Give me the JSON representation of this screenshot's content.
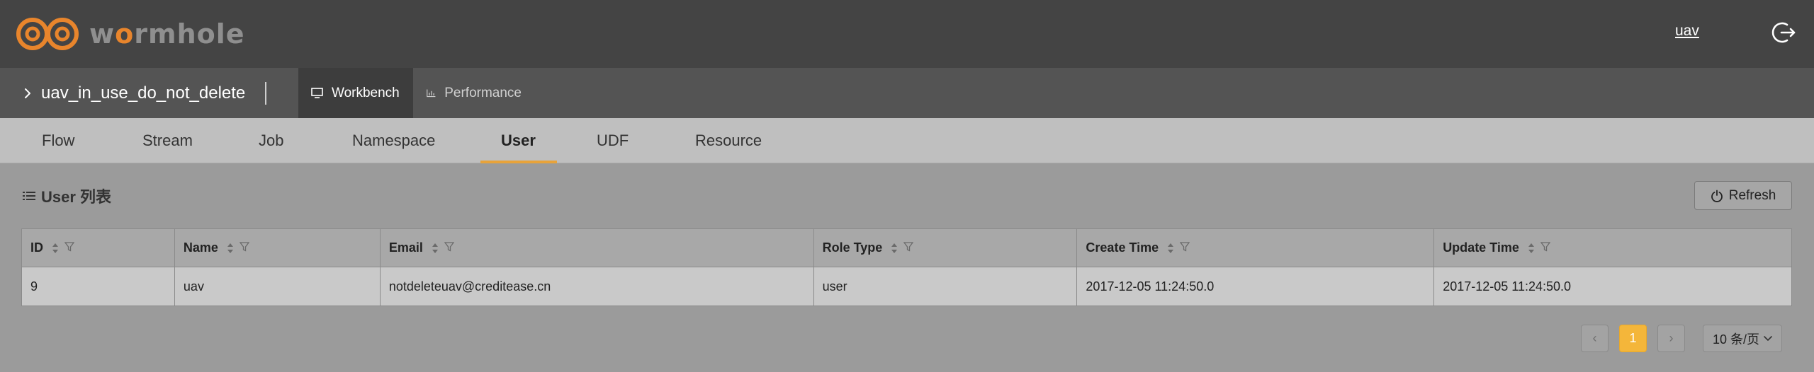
{
  "header": {
    "logo_text": "wormhole",
    "username": "uav"
  },
  "project_bar": {
    "project_name": "uav_in_use_do_not_delete",
    "tabs": [
      {
        "label": "Workbench",
        "icon": "monitor-icon",
        "active": true
      },
      {
        "label": "Performance",
        "icon": "bar-chart-icon",
        "active": false
      }
    ]
  },
  "subnav": {
    "tabs": [
      {
        "label": "Flow"
      },
      {
        "label": "Stream"
      },
      {
        "label": "Job"
      },
      {
        "label": "Namespace"
      },
      {
        "label": "User",
        "active": true
      },
      {
        "label": "UDF"
      },
      {
        "label": "Resource"
      }
    ]
  },
  "content": {
    "title": "User 列表",
    "refresh_label": "Refresh"
  },
  "table": {
    "columns": [
      "ID",
      "Name",
      "Email",
      "Role Type",
      "Create Time",
      "Update Time"
    ],
    "rows": [
      [
        "9",
        "uav",
        "notdeleteuav@creditease.cn",
        "user",
        "2017-12-05 11:24:50.0",
        "2017-12-05 11:24:50.0"
      ]
    ]
  },
  "pagination": {
    "prev": "‹",
    "current_page": "1",
    "next": "›",
    "page_size": "10 条/页"
  },
  "colors": {
    "accent": "#e8852c",
    "active_page": "#f4b63a",
    "topbar": "#444444"
  }
}
